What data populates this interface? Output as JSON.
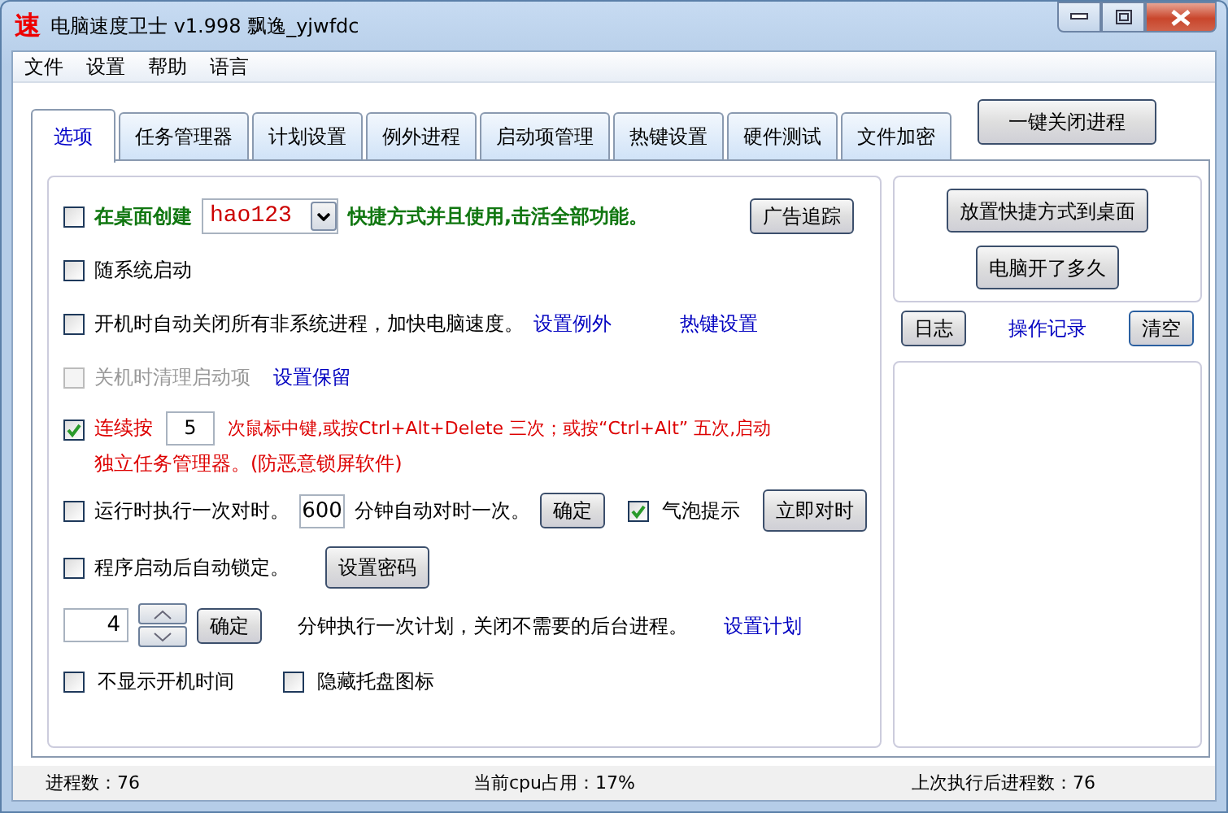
{
  "window": {
    "icon": "速",
    "title": "电脑速度卫士 v1.998 飘逸_yjwfdc"
  },
  "menu": [
    "文件",
    "设置",
    "帮助",
    "语言"
  ],
  "tabs": [
    {
      "label": "选项",
      "selected": true
    },
    {
      "label": "任务管理器",
      "selected": false
    },
    {
      "label": "计划设置",
      "selected": false
    },
    {
      "label": "例外进程",
      "selected": false
    },
    {
      "label": "启动项管理",
      "selected": false
    },
    {
      "label": "热键设置",
      "selected": false
    },
    {
      "label": "硬件测试",
      "selected": false
    },
    {
      "label": "文件加密",
      "selected": false
    }
  ],
  "close_all_button": "一键关闭进程",
  "options": {
    "desktop_shortcut": {
      "checked": false,
      "label_before": "在桌面创建",
      "dropdown": "hao123",
      "label_after": "快捷方式并且使用,击活全部功能。",
      "button": "广告追踪"
    },
    "autostart": {
      "checked": false,
      "label": "随系统启动"
    },
    "close_on_boot": {
      "checked": false,
      "label": "开机时自动关闭所有非系统进程，加快电脑速度。",
      "links": [
        "设置例外",
        "热键设置"
      ]
    },
    "clean_on_shutdown": {
      "checked": false,
      "disabled": true,
      "label": "关机时清理启动项",
      "link": "设置保留"
    },
    "taskmgr_hotkey": {
      "checked": true,
      "label_before": "连续按",
      "value": "5",
      "label_after": "次鼠标中键,或按Ctrl+Alt+Delete 三次；或按“Ctrl+Alt” 五次,启动",
      "label_line2": "独立任务管理器。(防恶意锁屏软件)"
    },
    "time_sync": {
      "checked": false,
      "label": "运行时执行一次对时。",
      "value": "600",
      "unit": "分钟自动对时一次。",
      "confirm": "确定",
      "bubble": {
        "checked": true,
        "label": "气泡提示"
      },
      "sync_now": "立即对时"
    },
    "auto_lock": {
      "checked": false,
      "label": "程序启动后自动锁定。",
      "button": "设置密码"
    },
    "schedule": {
      "value": "4",
      "confirm": "确定",
      "label": "分钟执行一次计划，关闭不需要的后台进程。",
      "link": "设置计划"
    },
    "bottom": [
      {
        "checked": false,
        "label": "不显示开机时间"
      },
      {
        "checked": false,
        "label": "隐藏托盘图标"
      }
    ]
  },
  "right_panel": {
    "buttons": [
      "放置快捷方式到桌面",
      "电脑开了多久"
    ],
    "log_button": "日志",
    "log_link": "操作记录",
    "clear_button": "清空"
  },
  "status_bar": [
    "进程数：76",
    "当前cpu占用：17%",
    "上次执行后进程数：76"
  ]
}
